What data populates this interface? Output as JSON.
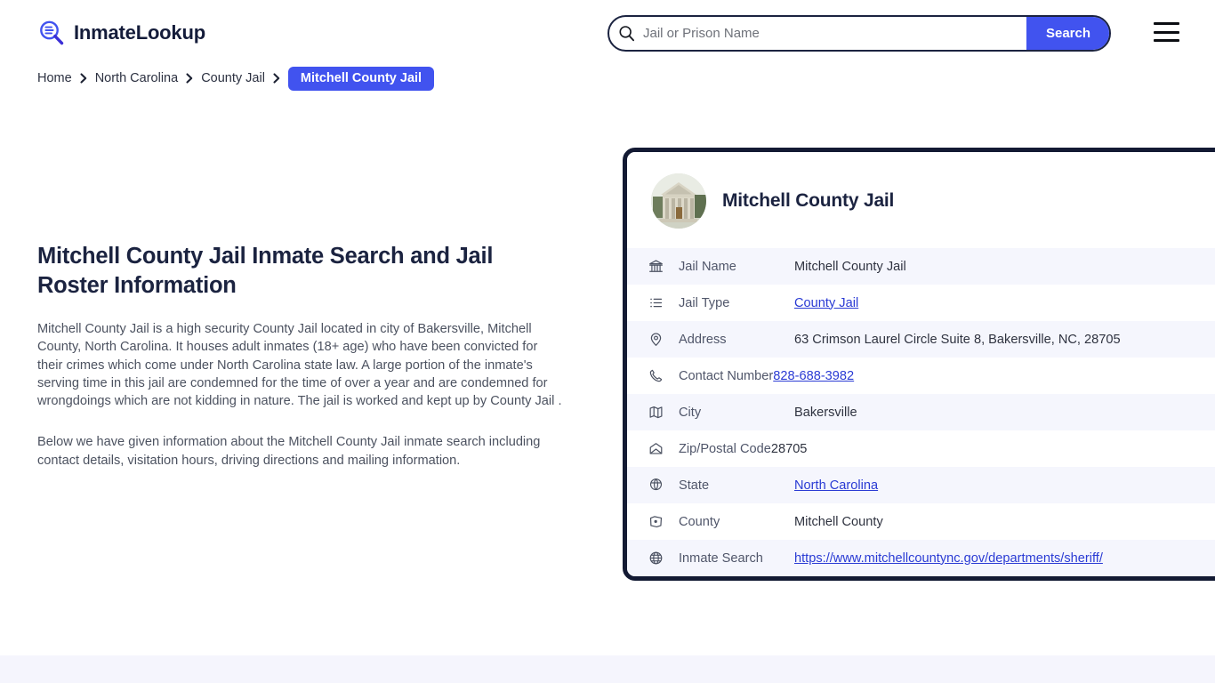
{
  "brand": {
    "name": "InmateLookup",
    "logo_icon": "magnifier-list-icon",
    "accent_color": "#4153ef",
    "dark_color": "#131a33"
  },
  "search": {
    "placeholder": "Jail or Prison Name",
    "value": "",
    "button_label": "Search",
    "icon": "search-icon"
  },
  "menu": {
    "icon": "hamburger-menu-icon"
  },
  "breadcrumb": {
    "items": [
      {
        "label": "Home",
        "current": false
      },
      {
        "label": "North Carolina",
        "current": false
      },
      {
        "label": "County Jail",
        "current": false
      },
      {
        "label": "Mitchell County Jail",
        "current": true
      }
    ],
    "separator": "›"
  },
  "article": {
    "heading": "Mitchell County Jail Inmate Search and Jail Roster Information",
    "paragraph1": "Mitchell County Jail is a high security County Jail located in city of Bakersville, Mitchell County, North Carolina. It houses adult inmates (18+ age) who have been convicted for their crimes which come under North Carolina state law. A large portion of the inmate's serving time in this jail are condemned for the time of over a year and are condemned for wrongdoings which are not kidding in nature. The jail is worked and kept up by County Jail .",
    "paragraph2": "Below we have given information about the Mitchell County Jail inmate search including contact details, visitation hours, driving directions and mailing information."
  },
  "card": {
    "title": "Mitchell County Jail",
    "avatar_icon": "courthouse-photo-avatar",
    "rows": [
      {
        "icon": "bank-building-icon",
        "label": "Jail Name",
        "value": "Mitchell County Jail",
        "link": false
      },
      {
        "icon": "list-icon",
        "label": "Jail Type",
        "value": "County Jail",
        "link": true
      },
      {
        "icon": "map-pin-icon",
        "label": "Address",
        "value": "63 Crimson Laurel Circle Suite 8, Bakersville, NC, 28705",
        "link": false
      },
      {
        "icon": "phone-icon",
        "label": "Contact Number",
        "value": "828-688-3982",
        "link": true
      },
      {
        "icon": "map-icon",
        "label": "City",
        "value": "Bakersville",
        "link": false
      },
      {
        "icon": "envelope-icon",
        "label": "Zip/Postal Code",
        "value": "28705",
        "link": false
      },
      {
        "icon": "globe-stand-icon",
        "label": "State",
        "value": "North Carolina",
        "link": true
      },
      {
        "icon": "map-area-icon",
        "label": "County",
        "value": "Mitchell County",
        "link": false
      },
      {
        "icon": "globe-icon",
        "label": "Inmate Search",
        "value": "https://www.mitchellcountync.gov/departments/sheriff/",
        "link": true
      }
    ]
  }
}
